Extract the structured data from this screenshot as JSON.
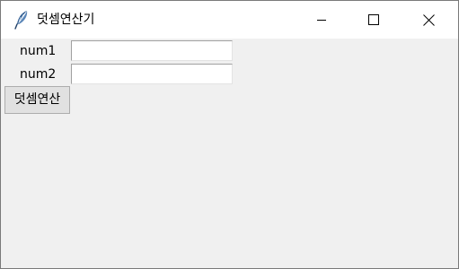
{
  "window": {
    "title": "덧셈연산기",
    "icon": "feather-icon",
    "controls": [
      "minimize-icon",
      "maximize-icon",
      "close-icon"
    ]
  },
  "form": {
    "num1_label": "num1",
    "num1_value": "",
    "num2_label": "num2",
    "num2_value": "",
    "button_label": "덧셈연산"
  },
  "colors": {
    "client_background": "#f0f0f0",
    "titlebar_background": "#ffffff",
    "button_face": "#e1e1e1",
    "feather_blue": "#2d5a8e"
  }
}
